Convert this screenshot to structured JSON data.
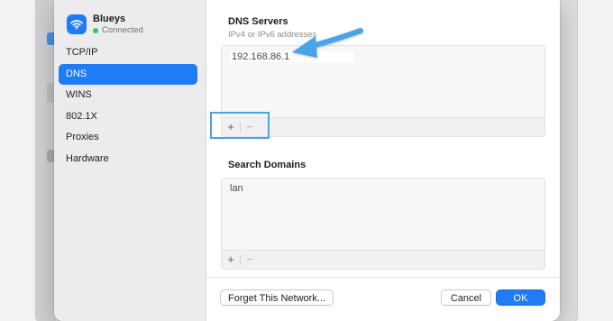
{
  "network": {
    "name": "Blueys",
    "status": "Connected"
  },
  "sidebar": {
    "items": [
      {
        "label": "TCP/IP",
        "active": false
      },
      {
        "label": "DNS",
        "active": true
      },
      {
        "label": "WINS",
        "active": false
      },
      {
        "label": "802.1X",
        "active": false
      },
      {
        "label": "Proxies",
        "active": false
      },
      {
        "label": "Hardware",
        "active": false
      }
    ]
  },
  "dns_servers": {
    "title": "DNS Servers",
    "subtitle": "IPv4 or IPv6 addresses",
    "entries": [
      "192.168.86.1"
    ],
    "add_label": "+",
    "remove_label": "−"
  },
  "search_domains": {
    "title": "Search Domains",
    "entries": [
      "lan"
    ],
    "add_label": "+",
    "remove_label": "−"
  },
  "footer": {
    "forget_label": "Forget This Network...",
    "cancel_label": "Cancel",
    "ok_label": "OK"
  },
  "icons": {
    "network": "wifi-icon",
    "status": "status-dot-icon",
    "annotation": "arrow-icon"
  },
  "colors": {
    "accent": "#1f7cf5",
    "status_connected": "#34c759",
    "annotation": "#4aa3e8"
  }
}
